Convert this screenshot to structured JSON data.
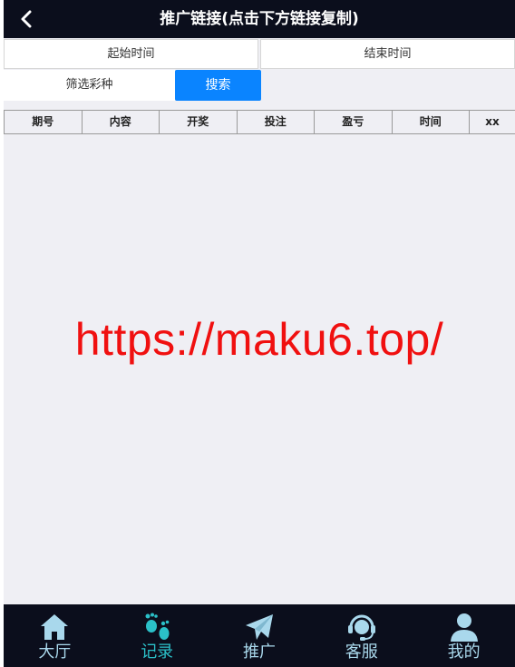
{
  "header": {
    "title": "推广链接(点击下方链接复制)"
  },
  "filters": {
    "start_time": "起始时间",
    "end_time": "结束时间",
    "lottery_select": "筛选彩种",
    "search_label": "搜索"
  },
  "table": {
    "columns": [
      "期号",
      "内容",
      "开奖",
      "投注",
      "盈亏",
      "时间",
      "xx"
    ]
  },
  "watermark": "https://maku6.top/",
  "nav": {
    "items": [
      {
        "label": "大厅",
        "icon": "home-icon"
      },
      {
        "label": "记录",
        "icon": "footprints-icon"
      },
      {
        "label": "推广",
        "icon": "paper-plane-icon"
      },
      {
        "label": "客服",
        "icon": "headset-icon"
      },
      {
        "label": "我的",
        "icon": "user-icon"
      }
    ],
    "active_index": 1
  },
  "colors": {
    "header_bg": "#0b0e1c",
    "accent": "#0a84ff",
    "nav_icon": "#a9d8ec",
    "nav_active": "#2bc0c8",
    "watermark": "#f01010"
  }
}
